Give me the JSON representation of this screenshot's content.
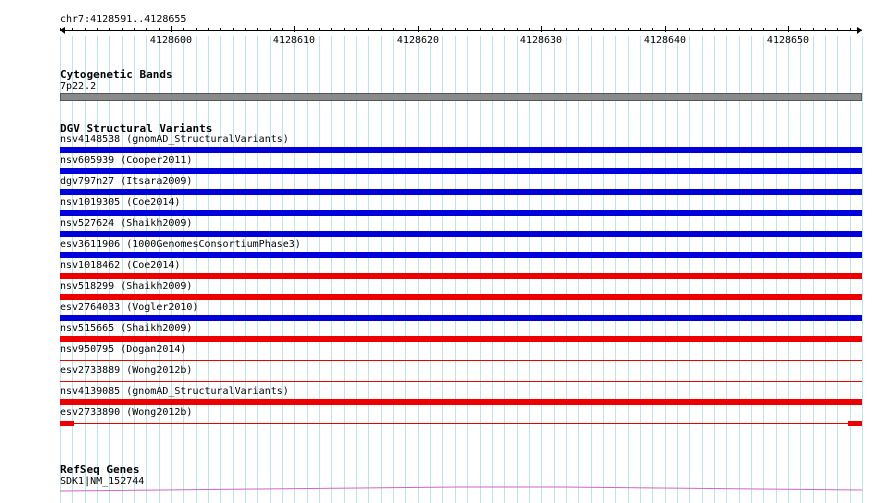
{
  "ruler": {
    "region": "chr7:4128591..4128655",
    "start": 4128591,
    "end": 4128655,
    "tick_labels": [
      "4128600",
      "4128610",
      "4128620",
      "4128630",
      "4128640",
      "4128650"
    ]
  },
  "cyto": {
    "title": "Cytogenetic Bands",
    "band": "7p22.2",
    "color": "#8a8a8a"
  },
  "dgv": {
    "title": "DGV Structural Variants",
    "colors": {
      "gain": "#0000dd",
      "loss": "#ee0000"
    },
    "variants": [
      {
        "label": "nsv4148538 (gnomAD_StructuralVariants)",
        "color": "#0000dd",
        "style": "thick"
      },
      {
        "label": "nsv605939 (Cooper2011)",
        "color": "#0000dd",
        "style": "thick"
      },
      {
        "label": "dgv797n27 (Itsara2009)",
        "color": "#0000dd",
        "style": "thick"
      },
      {
        "label": "nsv1019305 (Coe2014)",
        "color": "#0000dd",
        "style": "thick"
      },
      {
        "label": "nsv527624 (Shaikh2009)",
        "color": "#0000dd",
        "style": "thick"
      },
      {
        "label": "esv3611906 (1000GenomesConsortiumPhase3)",
        "color": "#0000dd",
        "style": "thick"
      },
      {
        "label": "nsv1018462 (Coe2014)",
        "color": "#ee0000",
        "style": "thick"
      },
      {
        "label": "nsv518299 (Shaikh2009)",
        "color": "#ee0000",
        "style": "thick"
      },
      {
        "label": "esv2764033 (Vogler2010)",
        "color": "#0000dd",
        "style": "thick"
      },
      {
        "label": "nsv515665 (Shaikh2009)",
        "color": "#ee0000",
        "style": "thick"
      },
      {
        "label": "nsv950795 (Dogan2014)",
        "color": "#ee0000",
        "style": "thin"
      },
      {
        "label": "esv2733889 (Wong2012b)",
        "color": "#ee0000",
        "style": "thin"
      },
      {
        "label": "nsv4139085 (gnomAD_StructuralVariants)",
        "color": "#ee0000",
        "style": "thick"
      },
      {
        "label": "esv2733890 (Wong2012b)",
        "color": "#ee0000",
        "style": "split"
      }
    ]
  },
  "refseq": {
    "title": "RefSeq Genes",
    "gene": "SDK1|NM_152744",
    "color": "#cc66cc"
  }
}
